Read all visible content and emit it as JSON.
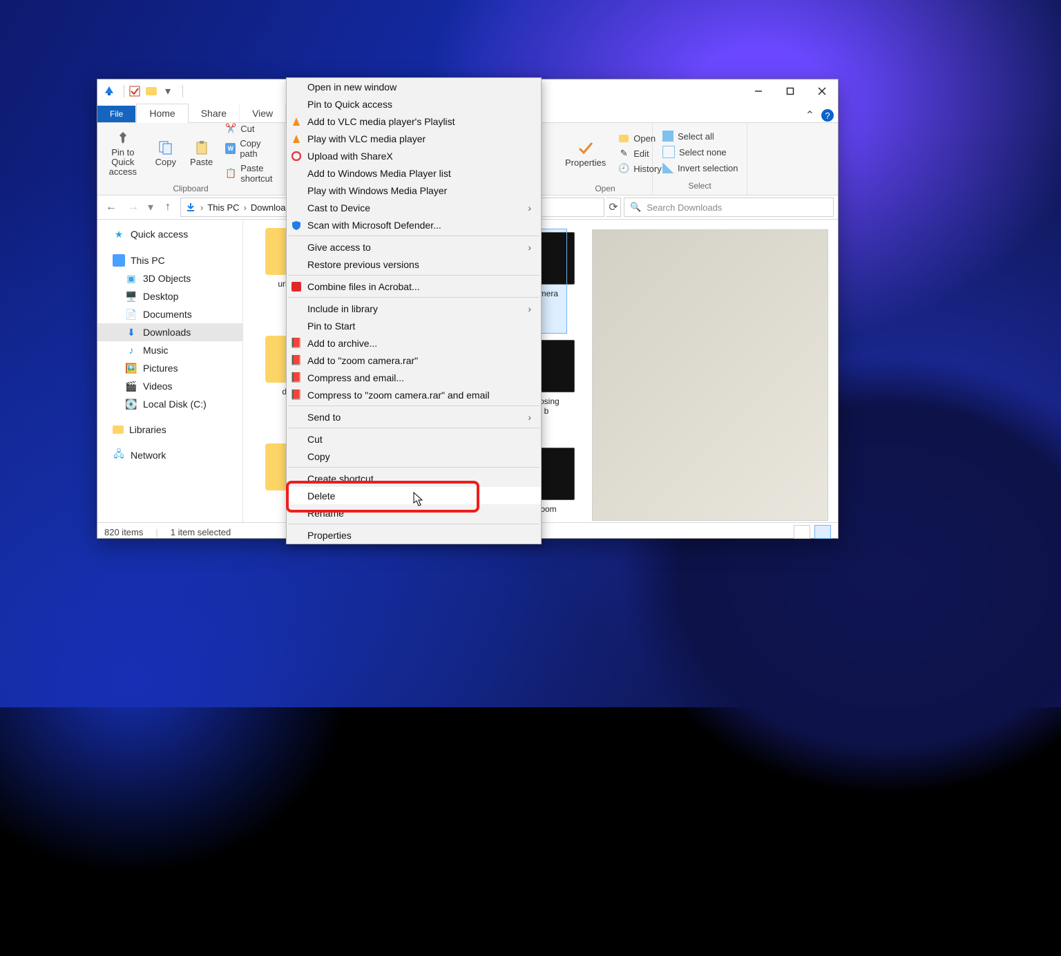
{
  "window": {
    "tabs": {
      "file": "File",
      "home": "Home",
      "share": "Share",
      "view": "View"
    }
  },
  "ribbon": {
    "pin": "Pin to Quick\naccess",
    "copy": "Copy",
    "paste": "Paste",
    "cut": "Cut",
    "copy_path": "Copy path",
    "paste_shortcut": "Paste shortcut",
    "group_clipboard": "Clipboard",
    "properties": "Properties",
    "open": "Open",
    "edit": "Edit",
    "history": "History",
    "group_open": "Open",
    "select_all": "Select all",
    "select_none": "Select none",
    "invert": "Invert selection",
    "group_select": "Select"
  },
  "breadcrumb": {
    "p1": "This PC",
    "p2": "Downloads"
  },
  "search": {
    "placeholder": "Search Downloads"
  },
  "sidebar": {
    "quick": "Quick access",
    "thispc": "This PC",
    "3d": "3D Objects",
    "desktop": "Desktop",
    "documents": "Documents",
    "downloads": "Downloads",
    "music": "Music",
    "pictures": "Pictures",
    "videos": "Videos",
    "localc": "Local Disk (C:)",
    "libraries": "Libraries",
    "network": "Network"
  },
  "files": {
    "f1": "url aut...",
    "selected": "amera",
    "f2": "dow...",
    "f3": "closing\nb",
    "f4": "zoom"
  },
  "status": {
    "items": "820 items",
    "selected": "1 item selected"
  },
  "context_menu": {
    "open_new": "Open in new window",
    "pin_quick": "Pin to Quick access",
    "vlc_add": "Add to VLC media player's Playlist",
    "vlc_play": "Play with VLC media player",
    "sharex": "Upload with ShareX",
    "wmp_add": "Add to Windows Media Player list",
    "wmp_play": "Play with Windows Media Player",
    "cast": "Cast to Device",
    "defender": "Scan with Microsoft Defender...",
    "give_access": "Give access to",
    "restore": "Restore previous versions",
    "acrobat": "Combine files in Acrobat...",
    "include_lib": "Include in library",
    "pin_start": "Pin to Start",
    "rar_add": "Add to archive...",
    "rar_add_name": "Add to \"zoom camera.rar\"",
    "rar_email": "Compress and email...",
    "rar_email_name": "Compress to \"zoom camera.rar\" and email",
    "send_to": "Send to",
    "cut": "Cut",
    "copy": "Copy",
    "shortcut": "Create shortcut",
    "delete": "Delete",
    "rename": "Rename",
    "properties": "Properties"
  }
}
